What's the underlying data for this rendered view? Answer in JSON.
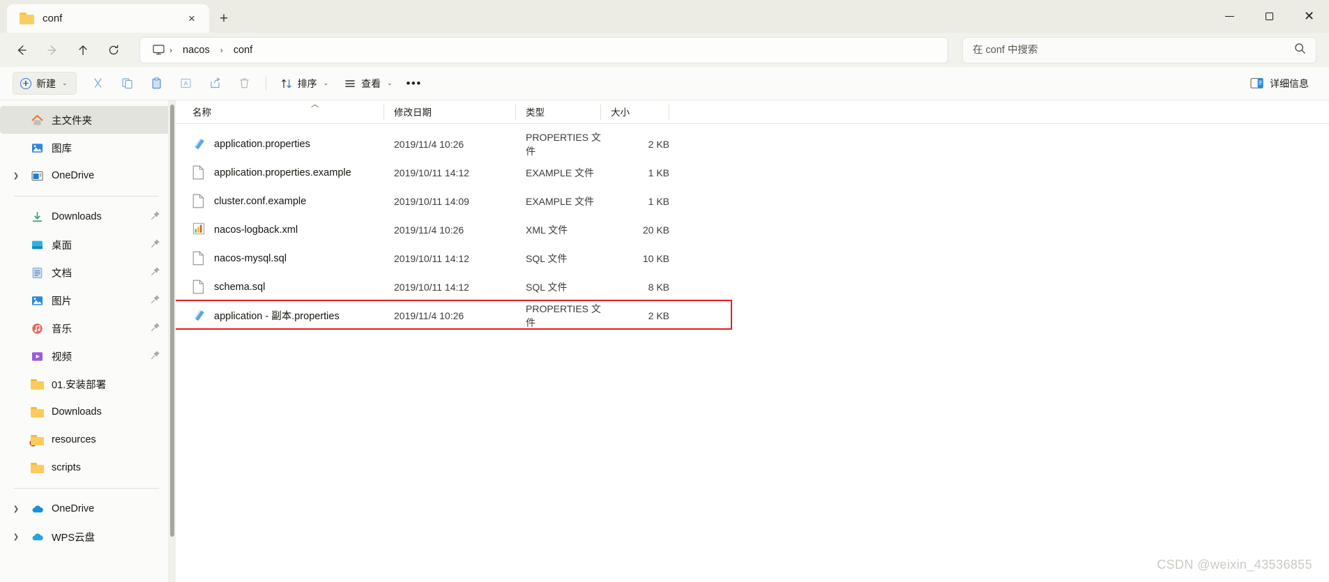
{
  "window": {
    "tab": {
      "title": "conf",
      "icon": "folder-icon",
      "close_label": "×"
    },
    "new_tab_label": "+",
    "controls": {
      "minimize": "−",
      "maximize": "▢",
      "close": "✕"
    }
  },
  "nav": {
    "back": "back-arrow",
    "forward": "forward-arrow",
    "up": "up-arrow",
    "refresh": "refresh-arrow",
    "breadcrumb": {
      "root_icon": "this-pc-icon",
      "items": [
        "nacos",
        "conf"
      ],
      "separator": "›"
    }
  },
  "search": {
    "placeholder": "在 conf 中搜索",
    "value": "",
    "icon": "search-icon"
  },
  "toolbar": {
    "new_label": "新建",
    "cut": "cut-icon",
    "copy": "copy-icon",
    "paste": "paste-icon",
    "rename": "rename-icon",
    "share": "share-icon",
    "delete": "delete-icon",
    "sort_label": "排序",
    "view_label": "查看",
    "overflow_label": "•••",
    "details_label": "详细信息"
  },
  "sidebar": {
    "groups": [
      {
        "items": [
          {
            "label": "主文件夹",
            "icon": "home-icon",
            "selected": true,
            "expandable": false,
            "pinned": false
          },
          {
            "label": "图库",
            "icon": "gallery-icon",
            "selected": false,
            "expandable": false,
            "pinned": false
          },
          {
            "label": "OneDrive",
            "icon": "onedrive-personal-icon",
            "selected": false,
            "expandable": true,
            "pinned": false
          }
        ]
      },
      {
        "items": [
          {
            "label": "Downloads",
            "icon": "downloads-icon",
            "selected": false,
            "expandable": false,
            "pinned": true
          },
          {
            "label": "桌面",
            "icon": "desktop-icon",
            "selected": false,
            "expandable": false,
            "pinned": true
          },
          {
            "label": "文档",
            "icon": "documents-icon",
            "selected": false,
            "expandable": false,
            "pinned": true
          },
          {
            "label": "图片",
            "icon": "pictures-icon",
            "selected": false,
            "expandable": false,
            "pinned": true
          },
          {
            "label": "音乐",
            "icon": "music-icon",
            "selected": false,
            "expandable": false,
            "pinned": true
          },
          {
            "label": "视频",
            "icon": "videos-icon",
            "selected": false,
            "expandable": false,
            "pinned": true
          },
          {
            "label": "01.安装部署",
            "icon": "folder-icon",
            "selected": false,
            "expandable": false,
            "pinned": false
          },
          {
            "label": "Downloads",
            "icon": "folder-icon",
            "selected": false,
            "expandable": false,
            "pinned": false
          },
          {
            "label": "resources",
            "icon": "folder-blocked-icon",
            "selected": false,
            "expandable": false,
            "pinned": false
          },
          {
            "label": "scripts",
            "icon": "folder-icon",
            "selected": false,
            "expandable": false,
            "pinned": false
          }
        ]
      },
      {
        "items": [
          {
            "label": "OneDrive",
            "icon": "onedrive-cloud-icon",
            "selected": false,
            "expandable": true,
            "pinned": false
          },
          {
            "label": "WPS云盘",
            "icon": "wps-cloud-icon",
            "selected": false,
            "expandable": true,
            "pinned": false
          }
        ]
      }
    ]
  },
  "filelist": {
    "columns": [
      {
        "key": "name",
        "label": "名称",
        "sorted": true,
        "sort_caret": "︿"
      },
      {
        "key": "date",
        "label": "修改日期"
      },
      {
        "key": "type",
        "label": "类型"
      },
      {
        "key": "size",
        "label": "大小"
      }
    ],
    "rows": [
      {
        "name": "application.properties",
        "date": "2019/11/4 10:26",
        "type": "PROPERTIES 文件",
        "size": "2 KB",
        "icon": "properties-file-icon",
        "selected": false,
        "highlighted": false
      },
      {
        "name": "application.properties.example",
        "date": "2019/10/11 14:12",
        "type": "EXAMPLE 文件",
        "size": "1 KB",
        "icon": "blank-file-icon",
        "selected": false,
        "highlighted": false
      },
      {
        "name": "cluster.conf.example",
        "date": "2019/10/11 14:09",
        "type": "EXAMPLE 文件",
        "size": "1 KB",
        "icon": "blank-file-icon",
        "selected": false,
        "highlighted": false
      },
      {
        "name": "nacos-logback.xml",
        "date": "2019/11/4 10:26",
        "type": "XML 文件",
        "size": "20 KB",
        "icon": "xml-file-icon",
        "selected": false,
        "highlighted": false
      },
      {
        "name": "nacos-mysql.sql",
        "date": "2019/10/11 14:12",
        "type": "SQL 文件",
        "size": "10 KB",
        "icon": "blank-file-icon",
        "selected": false,
        "highlighted": false
      },
      {
        "name": "schema.sql",
        "date": "2019/10/11 14:12",
        "type": "SQL 文件",
        "size": "8 KB",
        "icon": "blank-file-icon",
        "selected": false,
        "highlighted": false
      },
      {
        "name": "application - 副本.properties",
        "date": "2019/11/4 10:26",
        "type": "PROPERTIES 文件",
        "size": "2 KB",
        "icon": "properties-file-icon",
        "selected": false,
        "highlighted": true
      }
    ]
  },
  "watermark": {
    "text": "CSDN @weixin_43536855"
  },
  "colors": {
    "accent": "#2f6fd0",
    "highlight_border": "#e81b23",
    "titlebar_bg": "#ecece4",
    "sidebar_bg": "#fbfbf9",
    "selection_bg": "#e3e3dd",
    "folder_yellow": "#fbcc5c"
  }
}
